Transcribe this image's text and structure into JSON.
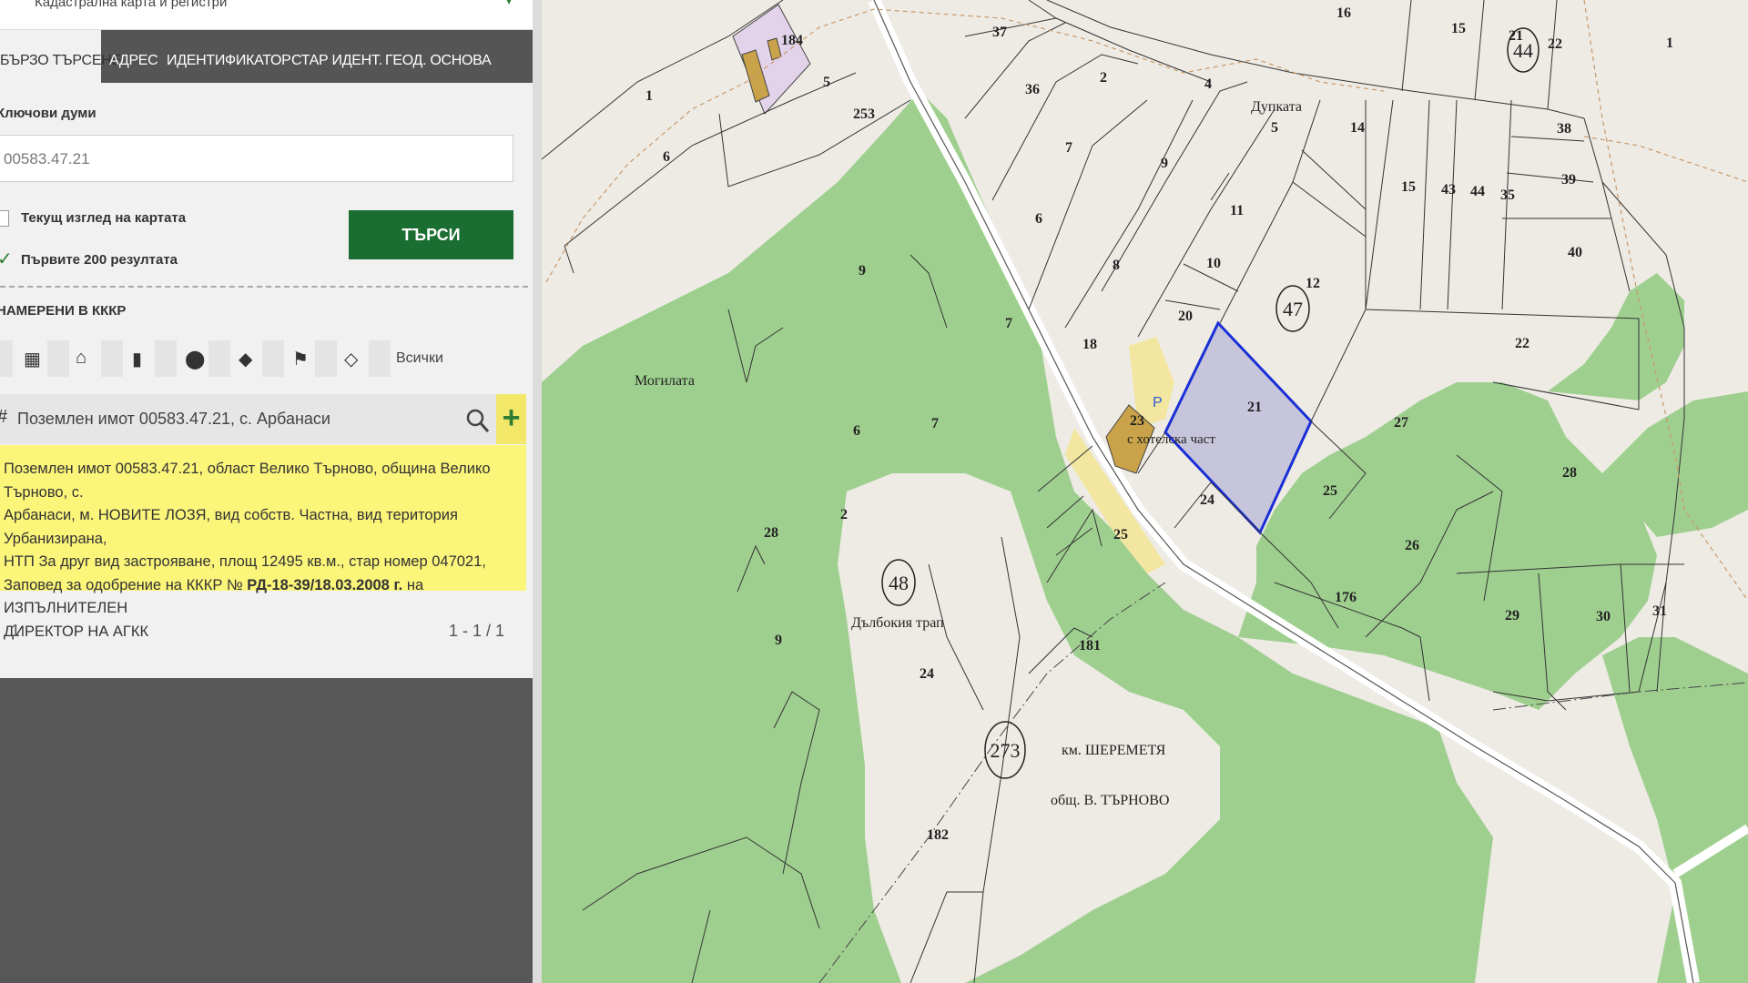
{
  "panel": {
    "title": "Кадастрална карта и регистри",
    "tabs": [
      "БЪРЗО ТЪРСЕНЕ",
      "АДРЕС",
      "ИДЕНТИФИКАТОР",
      "СТАР ИДЕНТ.",
      "ГЕОД. ОСНОВА"
    ],
    "keywords_label": "Ключови думи",
    "keywords_value": "00583.47.21",
    "current_view_label": "Текущ изглед на картата",
    "first200_label": "Първите 200 резултата",
    "search_button": "ТЪРСИ",
    "found_label": "НАМЕРЕНИ В КККР",
    "filter_all": "Всички",
    "result_title": "Поземлен имот 00583.47.21, с. Арбанаси",
    "info_line1": "Поземлен имот 00583.47.21, област Велико Търново, община Велико Търново, с.",
    "info_line2": "Арбанаси, м. НОВИТЕ ЛОЗЯ, вид собств. Частна, вид територия Урбанизирана,",
    "info_line3": "НТП За друг вид застрояване, площ 12495 кв.м., стар номер 047021,",
    "info_line4_pre": "Заповед за одобрение на КККР № ",
    "info_line4_bold": "РД-18-39/18.03.2008 г.",
    "info_line4_post": " на ИЗПЪЛНИТЕЛЕН",
    "info_line5": "ДИРЕКТОР НА АГКК",
    "page_current": "1",
    "page_range": "1 - 1 / 1"
  },
  "map": {
    "labels": {
      "n184": "184",
      "n253": "253",
      "n1a": "1",
      "n5a": "5",
      "n6a": "6",
      "n37": "37",
      "n36": "36",
      "n2a": "2",
      "n4": "4",
      "n16": "16",
      "n15a": "15",
      "n21a": "21",
      "n22a": "22",
      "n1b": "1",
      "dupkata": "Дупката",
      "n5b": "5",
      "n14": "14",
      "n38": "38",
      "n7a": "7",
      "n9a": "9",
      "n11": "11",
      "n15b": "15",
      "n43": "43",
      "n44b": "44",
      "n35": "35",
      "n39": "39",
      "n6b": "6",
      "n8": "8",
      "n10": "10",
      "n12": "12",
      "n40": "40",
      "n9b": "9",
      "n7b": "7",
      "n20": "20",
      "n18": "18",
      "n22b": "22",
      "mogilata": "Могилата",
      "n21b": "21",
      "n23": "23",
      "hotel": "с хотелска част",
      "n27": "27",
      "n6c": "6",
      "n7c": "7",
      "n28a": "28",
      "n24a": "24",
      "n25a": "25",
      "n28b": "28",
      "n2b": "2",
      "n25b": "25",
      "n26": "26",
      "dalbokia": "Дълбокия трап",
      "n176": "176",
      "n29": "29",
      "n30": "30",
      "n31": "31",
      "n9c": "9",
      "n181": "181",
      "n24b": "24",
      "shereme": "км. ШЕРЕМЕТЯ",
      "obsht": "общ. В. ТЪРНОВО",
      "n182": "182",
      "parking": "P"
    },
    "circles": {
      "c44": "44",
      "c47": "47",
      "c48": "48",
      "c273": "273"
    },
    "colors": {
      "forest": "#9fcf8f",
      "land": "#eeebe5",
      "selected_fill": "#c7c5dc",
      "selected_stroke": "#1a2fd6",
      "building": "#c9a24a",
      "urban": "#f2e6a0",
      "church": "#e3d3ea"
    }
  }
}
